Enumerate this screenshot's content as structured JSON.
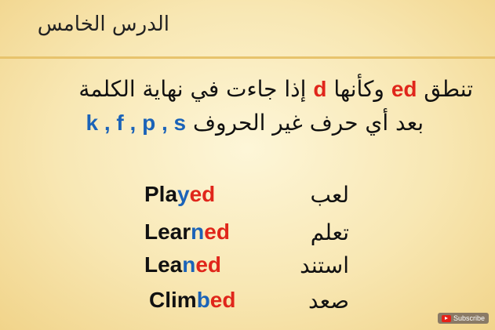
{
  "title": "الدرس الخامس",
  "rule": {
    "line1_before": "تنطق ",
    "line1_ed": "ed",
    "line1_mid": " وكأنها ",
    "line1_d": "d",
    "line1_after": " إذا جاءت في نهاية الكلمة",
    "line2_text": "بعد أي حرف غير الحروف ",
    "line2_letters": "k , f , p , s"
  },
  "words": [
    {
      "stem": "Pla",
      "hl": "y",
      "suffix": "ed",
      "arabic": "لعب"
    },
    {
      "stem": "Lear",
      "hl": "n",
      "suffix": "ed",
      "arabic": "تعلم"
    },
    {
      "stem": "Lea",
      "hl": "n",
      "suffix": "ed",
      "arabic": "استند"
    },
    {
      "stem": "Clim",
      "hl": "b",
      "suffix": "ed",
      "arabic": "صعد"
    }
  ],
  "subscribe_label": "Subscribe",
  "colors": {
    "red": "#e0261b",
    "blue": "#1b63b8"
  }
}
